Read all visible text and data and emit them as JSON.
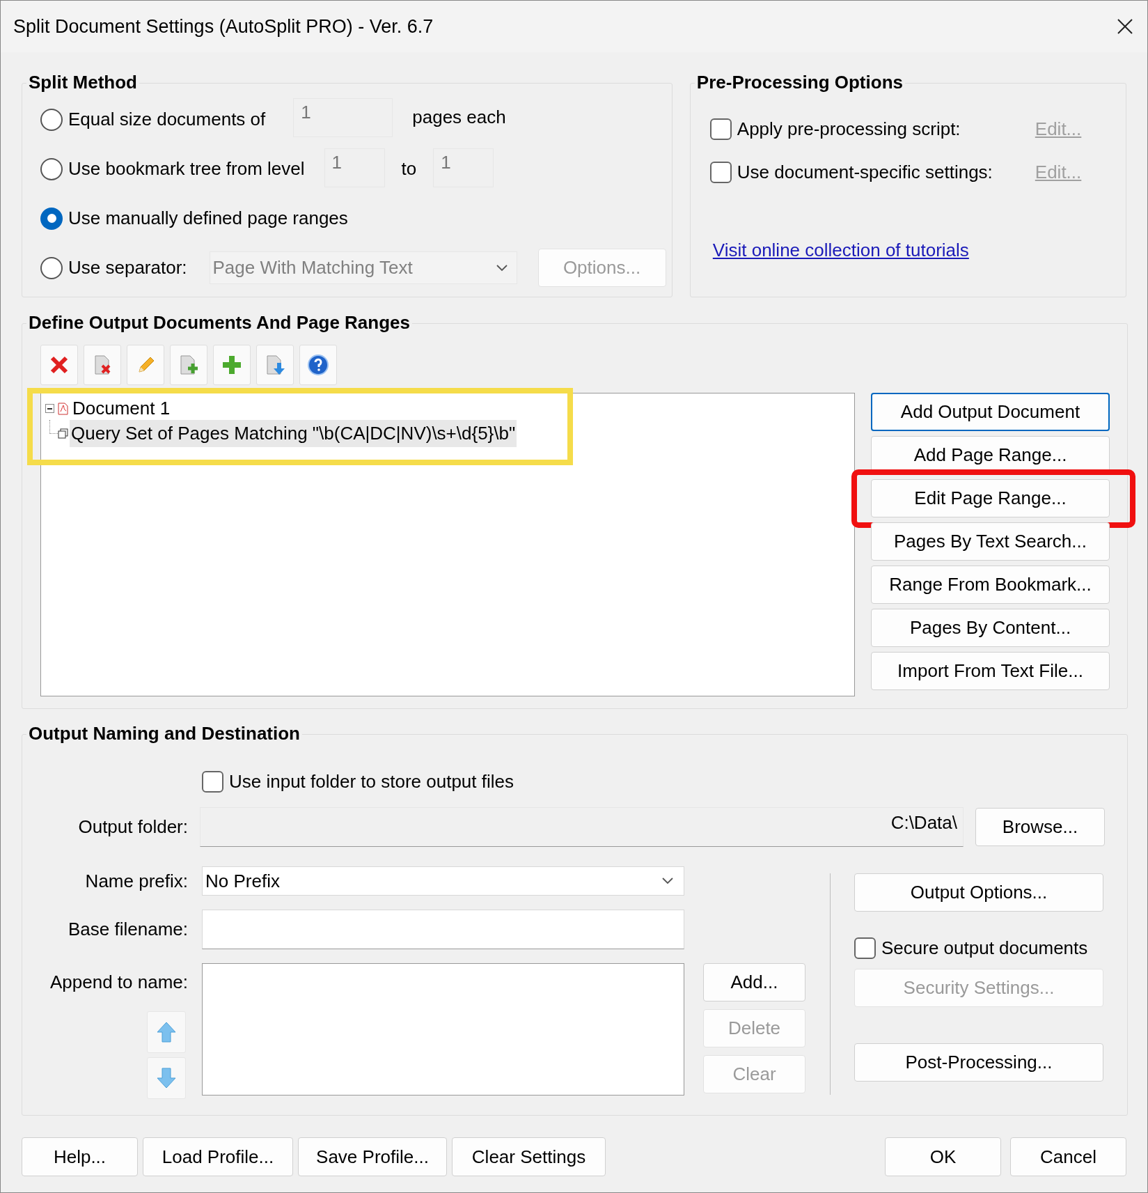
{
  "window": {
    "title": "Split Document Settings (AutoSplit PRO) - Ver. 6.7"
  },
  "split_method": {
    "title": "Split Method",
    "options": [
      {
        "kind": "equal",
        "label": "Equal size documents of",
        "selected": false,
        "value": "1",
        "suffix": "pages each"
      },
      {
        "kind": "bookmark",
        "label": "Use bookmark tree from level",
        "selected": false,
        "from": "1",
        "to_label": "to",
        "to": "1"
      },
      {
        "kind": "manual",
        "label": "Use manually defined page ranges",
        "selected": true
      },
      {
        "kind": "separator",
        "label": "Use separator:",
        "selected": false,
        "dropdown": "Page With Matching Text",
        "button": "Options...",
        "disabled": true
      }
    ]
  },
  "pre_processing": {
    "title": "Pre-Processing Options",
    "options": [
      {
        "label": "Apply pre-processing script:",
        "checked": false,
        "link": "Edit..."
      },
      {
        "label": "Use document-specific settings:",
        "checked": false,
        "link": "Edit..."
      }
    ],
    "link": "Visit online collection of tutorials"
  },
  "define": {
    "title": "Define Output Documents And Page Ranges",
    "highlighted": true,
    "tree": [
      {
        "label": "Document 1",
        "expanded": true,
        "selected": false,
        "children": [
          {
            "label": "Query Set of Pages Matching \"\\b(CA|DC|NV)\\s+\\d{5}\\b\"",
            "selected": true
          }
        ]
      }
    ],
    "buttons": [
      {
        "label": "Add Output Document",
        "default": true,
        "highlighted": false
      },
      {
        "label": "Add Page Range...",
        "default": false,
        "highlighted": false
      },
      {
        "label": "Edit Page Range...",
        "default": false,
        "highlighted": true
      },
      {
        "label": "Pages By Text Search...",
        "default": false,
        "highlighted": false
      },
      {
        "label": "Range From Bookmark...",
        "default": false,
        "highlighted": false
      },
      {
        "label": "Pages By Content...",
        "default": false,
        "highlighted": false
      },
      {
        "label": "Import From Text File...",
        "default": false,
        "highlighted": false
      }
    ]
  },
  "output": {
    "title": "Output Naming and Destination",
    "use_input_folder": {
      "label": "Use input folder to store output files",
      "checked": false
    },
    "output_folder": {
      "label": "Output folder:",
      "value": "C:\\Data\\"
    },
    "browse": "Browse...",
    "name_prefix": {
      "label": "Name prefix:",
      "value": "No Prefix"
    },
    "base_filename": {
      "label": "Base filename:"
    },
    "append": {
      "label": "Append to name:"
    },
    "list_buttons": [
      {
        "label": "Add...",
        "disabled": false
      },
      {
        "label": "Delete",
        "disabled": true
      },
      {
        "label": "Clear",
        "disabled": true
      }
    ],
    "output_options": "Output Options...",
    "secure": {
      "label": "Secure output documents",
      "checked": false
    },
    "security_settings": {
      "label": "Security Settings...",
      "disabled": true
    },
    "post_processing": "Post-Processing..."
  },
  "footer": {
    "left": [
      "Help...",
      "Load Profile...",
      "Save Profile...",
      "Clear Settings"
    ],
    "right": [
      "OK",
      "Cancel"
    ]
  }
}
